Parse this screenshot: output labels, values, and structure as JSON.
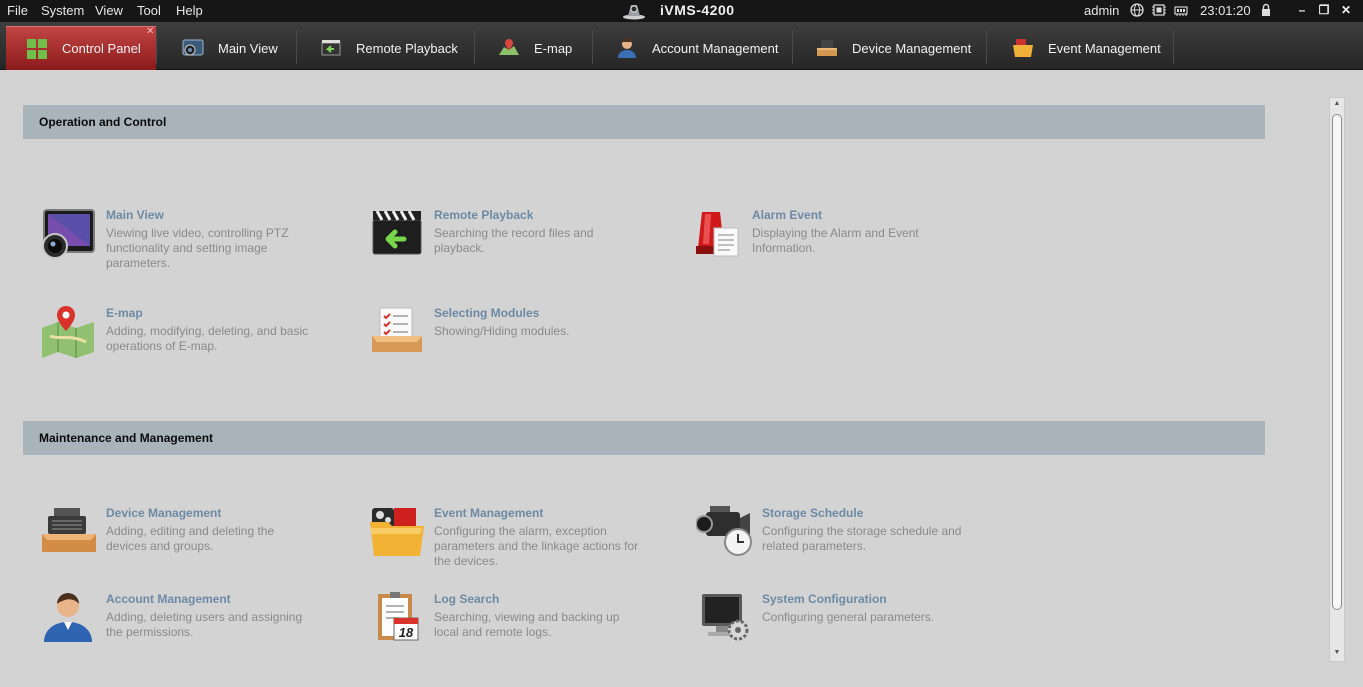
{
  "menubar": {
    "items": [
      "File",
      "System",
      "View",
      "Tool",
      "Help"
    ],
    "app_title": "iVMS-4200",
    "user": "admin",
    "clock": "23:01:20",
    "status_icons": [
      "globe-icon",
      "cpu-icon",
      "ram-icon",
      "lock-icon"
    ],
    "window_controls": [
      "minimize",
      "restore",
      "close"
    ]
  },
  "tabs": [
    {
      "label": "Control Panel",
      "icon": "control-panel-icon",
      "active": true
    },
    {
      "label": "Main View",
      "icon": "main-view-icon"
    },
    {
      "label": "Remote Playback",
      "icon": "remote-playback-icon"
    },
    {
      "label": "E-map",
      "icon": "emap-icon"
    },
    {
      "label": "Account Management",
      "icon": "account-icon"
    },
    {
      "label": "Device Management",
      "icon": "device-icon"
    },
    {
      "label": "Event Management",
      "icon": "event-icon"
    }
  ],
  "sections": [
    {
      "title": "Operation and Control",
      "modules": [
        {
          "title": "Main View",
          "desc": [
            "Viewing live video, controlling PTZ",
            "functionality and setting image",
            "parameters."
          ],
          "icon": "camera-lens-icon"
        },
        {
          "title": "Remote Playback",
          "desc": [
            "Searching the record files and",
            "playback."
          ],
          "icon": "clapper-playback-icon"
        },
        {
          "title": "Alarm Event",
          "desc": [
            "Displaying the Alarm and Event",
            "Information."
          ],
          "icon": "alarm-light-icon"
        },
        {
          "title": "E-map",
          "desc": [
            "Adding, modifying, deleting, and basic",
            "operations of E-map."
          ],
          "icon": "map-pin-icon"
        },
        {
          "title": "Selecting Modules",
          "desc": [
            "Showing/Hiding modules."
          ],
          "icon": "checklist-tray-icon"
        }
      ]
    },
    {
      "title": "Maintenance and Management",
      "modules": [
        {
          "title": "Device Management",
          "desc": [
            "Adding, editing and deleting the",
            "devices and groups."
          ],
          "icon": "device-tray-icon"
        },
        {
          "title": "Event Management",
          "desc": [
            "Configuring the alarm, exception",
            "parameters and the linkage actions for",
            "the devices."
          ],
          "icon": "event-folder-icon"
        },
        {
          "title": "Storage Schedule",
          "desc": [
            "Configuring the storage schedule and",
            "related parameters."
          ],
          "icon": "camcorder-clock-icon"
        },
        {
          "title": "Account Management",
          "desc": [
            "Adding, deleting users and assigning",
            "the permissions."
          ],
          "icon": "user-avatar-icon"
        },
        {
          "title": "Log Search",
          "desc": [
            "Searching, viewing and backing up",
            "local and remote logs."
          ],
          "icon": "calendar-clipboard-icon"
        },
        {
          "title": "System Configuration",
          "desc": [
            "Configuring general parameters."
          ],
          "icon": "monitor-gear-icon"
        }
      ]
    }
  ],
  "calendar_day": "18",
  "colors": {
    "active_tab": "#b03030",
    "section_header": "#a9b4ba",
    "module_title": "#6d8aa4",
    "module_desc": "#8a8a8a",
    "background": "#d3d3d3"
  }
}
